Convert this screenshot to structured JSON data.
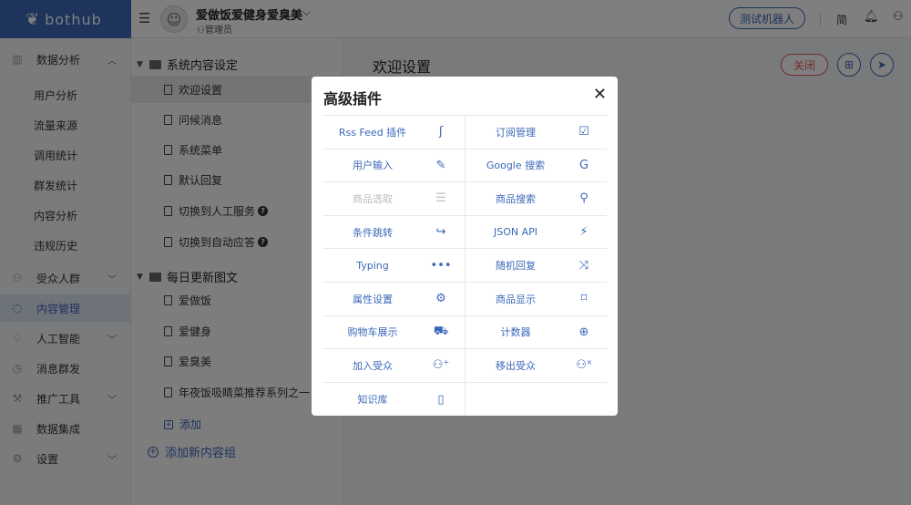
{
  "app": {
    "logo_text": "bothub"
  },
  "header": {
    "bot_name": "爱做饭爱健身爱臭美",
    "bot_role": "管理员",
    "test_button": "测试机器人",
    "lang": "简"
  },
  "sidenav": {
    "groups": [
      {
        "label": "数据分析",
        "icon": "bar-chart-icon"
      },
      {
        "label": "受众人群",
        "icon": "users-icon"
      },
      {
        "label": "内容管理",
        "icon": "chat-bubble-icon"
      },
      {
        "label": "人工智能",
        "icon": "brain-icon"
      },
      {
        "label": "消息群发",
        "icon": "clock-icon"
      },
      {
        "label": "推广工具",
        "icon": "tools-icon"
      },
      {
        "label": "数据集成",
        "icon": "grid-icon"
      },
      {
        "label": "设置",
        "icon": "gear-icon"
      }
    ],
    "sub_items": [
      "用户分析",
      "流量来源",
      "调用统计",
      "群发统计",
      "内容分析",
      "违规历史"
    ]
  },
  "tree": {
    "group1": "系统内容设定",
    "group1_items": [
      "欢迎设置",
      "问候消息",
      "系统菜单",
      "默认回复",
      "切换到人工服务",
      "切换到自动应答"
    ],
    "group2": "每日更新图文",
    "group2_items": [
      "爱做饭",
      "爱健身",
      "爱臭美",
      "年夜饭吸睛菜推荐系列之一"
    ],
    "add_item": "添加",
    "add_group": "添加新内容组"
  },
  "main": {
    "title": "欢迎设置",
    "close_button": "关闭"
  },
  "modal": {
    "title": "高级插件",
    "plugins": [
      {
        "label": "Rss Feed 插件",
        "icon": "rss-icon",
        "enabled": true
      },
      {
        "label": "订阅管理",
        "icon": "edit-square-icon",
        "enabled": true
      },
      {
        "label": "用户输入",
        "icon": "pencil-icon",
        "enabled": true
      },
      {
        "label": "Google 搜索",
        "icon": "google-icon",
        "enabled": true
      },
      {
        "label": "商品选取",
        "icon": "list-search-icon",
        "enabled": false
      },
      {
        "label": "商品搜索",
        "icon": "search-icon",
        "enabled": true
      },
      {
        "label": "条件跳转",
        "icon": "share-arrow-icon",
        "enabled": true
      },
      {
        "label": "JSON API",
        "icon": "plug-icon",
        "enabled": true
      },
      {
        "label": "Typing",
        "icon": "ellipsis-icon",
        "enabled": true
      },
      {
        "label": "随机回复",
        "icon": "shuffle-icon",
        "enabled": true
      },
      {
        "label": "属性设置",
        "icon": "gear-icon",
        "enabled": true
      },
      {
        "label": "商品显示",
        "icon": "tag-icon",
        "enabled": true
      },
      {
        "label": "购物车展示",
        "icon": "cart-icon",
        "enabled": true
      },
      {
        "label": "计数器",
        "icon": "plus-circle-icon",
        "enabled": true
      },
      {
        "label": "加入受众",
        "icon": "user-add-icon",
        "enabled": true
      },
      {
        "label": "移出受众",
        "icon": "user-remove-icon",
        "enabled": true
      },
      {
        "label": "知识库",
        "icon": "book-icon",
        "enabled": true
      }
    ]
  }
}
